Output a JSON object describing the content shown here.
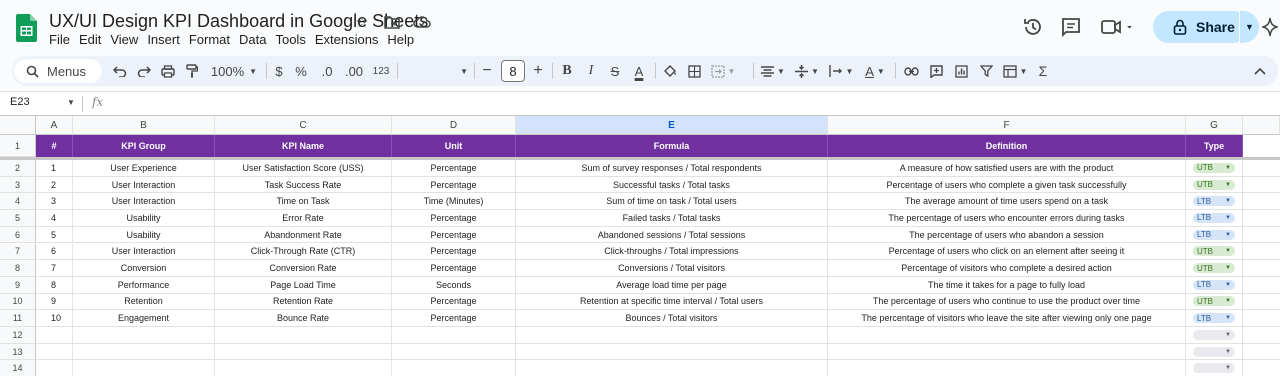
{
  "doc": {
    "title": "UX/UI Design KPI Dashboard in Google Sheets",
    "menus": [
      "File",
      "Edit",
      "View",
      "Insert",
      "Format",
      "Data",
      "Tools",
      "Extensions",
      "Help"
    ]
  },
  "header_controls": {
    "share_label": "Share"
  },
  "toolbar": {
    "menus_label": "Menus",
    "zoom": "100%",
    "currency": "$",
    "percent": "%",
    "dec_decrease": ".0",
    "dec_increase": ".00",
    "number_format": "123",
    "font_size": "8",
    "bold": "B",
    "italic": "I",
    "strike": "S",
    "text_color": "A",
    "sigma": "Σ"
  },
  "formula_bar": {
    "cell_ref": "E23",
    "fx": "fx"
  },
  "columns": [
    "A",
    "B",
    "C",
    "D",
    "E",
    "F",
    "G"
  ],
  "selected_column": "E",
  "row_numbers": [
    "1",
    "2",
    "3",
    "4",
    "5",
    "6",
    "7",
    "8",
    "9",
    "10",
    "11",
    "12",
    "13",
    "14"
  ],
  "table": {
    "headers": [
      "#",
      "KPI Group",
      "KPI Name",
      "Unit",
      "Formula",
      "Definition",
      "Type"
    ],
    "rows": [
      [
        "1",
        "User Experience",
        "User Satisfaction Score (USS)",
        "Percentage",
        "Sum of survey responses / Total respondents",
        "A measure of how satisfied users are with the product",
        "UTB"
      ],
      [
        "2",
        "User Interaction",
        "Task Success Rate",
        "Percentage",
        "Successful tasks / Total tasks",
        "Percentage of users who complete a given task successfully",
        "UTB"
      ],
      [
        "3",
        "User Interaction",
        "Time on Task",
        "Time (Minutes)",
        "Sum of time on task / Total users",
        "The average amount of time users spend on a task",
        "LTB"
      ],
      [
        "4",
        "Usability",
        "Error Rate",
        "Percentage",
        "Failed tasks / Total tasks",
        "The percentage of users who encounter errors during tasks",
        "LTB"
      ],
      [
        "5",
        "Usability",
        "Abandonment Rate",
        "Percentage",
        "Abandoned sessions / Total sessions",
        "The percentage of users who abandon a session",
        "LTB"
      ],
      [
        "6",
        "User Interaction",
        "Click-Through Rate (CTR)",
        "Percentage",
        "Click-throughs / Total impressions",
        "Percentage of users who click on an element after seeing it",
        "UTB"
      ],
      [
        "7",
        "Conversion",
        "Conversion Rate",
        "Percentage",
        "Conversions / Total visitors",
        "Percentage of visitors who complete a desired action",
        "UTB"
      ],
      [
        "8",
        "Performance",
        "Page Load Time",
        "Seconds",
        "Average load time per page",
        "The time it takes for a page to fully load",
        "LTB"
      ],
      [
        "9",
        "Retention",
        "Retention Rate",
        "Percentage",
        "Retention at specific time interval / Total users",
        "The percentage of users who continue to use the product over time",
        "UTB"
      ],
      [
        "10",
        "Engagement",
        "Bounce Rate",
        "Percentage",
        "Bounces / Total visitors",
        "The percentage of visitors who leave the site after viewing only one page",
        "LTB"
      ]
    ]
  },
  "colors": {
    "header_bg": "#7030a0",
    "utb_chip": "#d9ead3",
    "ltb_chip": "#d6e4f7",
    "share_bg": "#c2e7ff"
  }
}
